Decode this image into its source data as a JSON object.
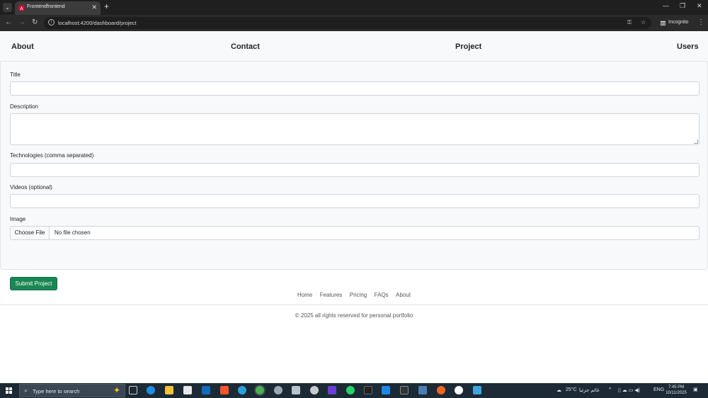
{
  "browser": {
    "tab_title": "Frontendfrontend",
    "tab_close": "✕",
    "new_tab": "+",
    "url": "localhost:4200/dashboard/project",
    "incognito_label": "Incognito",
    "window_controls": {
      "minimize": "—",
      "restore": "❐",
      "close": "✕"
    }
  },
  "navbar": {
    "about": "About",
    "contact": "Contact",
    "project": "Project",
    "users": "Users"
  },
  "form": {
    "title_label": "Title",
    "title_value": "",
    "description_label": "Description",
    "description_value": "",
    "technologies_label": "Technologies (comma separated)",
    "technologies_value": "",
    "videos_label": "Videos (optional)",
    "videos_value": "",
    "image_label": "Image",
    "choose_file": "Choose File",
    "file_status": "No file chosen",
    "submit": "Submit Project"
  },
  "footer": {
    "links": [
      "Home",
      "Features",
      "Pricing",
      "FAQs",
      "About"
    ],
    "copyright": "© 2025 all rights reserved for personal portfolio"
  },
  "taskbar": {
    "search_placeholder": "Type here to search",
    "weather": "25°C",
    "weather_desc": "غائم جزئيا",
    "language": "ENG",
    "time": "7:45 PM",
    "date": "10/11/2025"
  },
  "colors": {
    "submit_bg": "#198754",
    "navbar_bg": "#f8f9fa",
    "taskbar_bg": "#1c2a36"
  }
}
